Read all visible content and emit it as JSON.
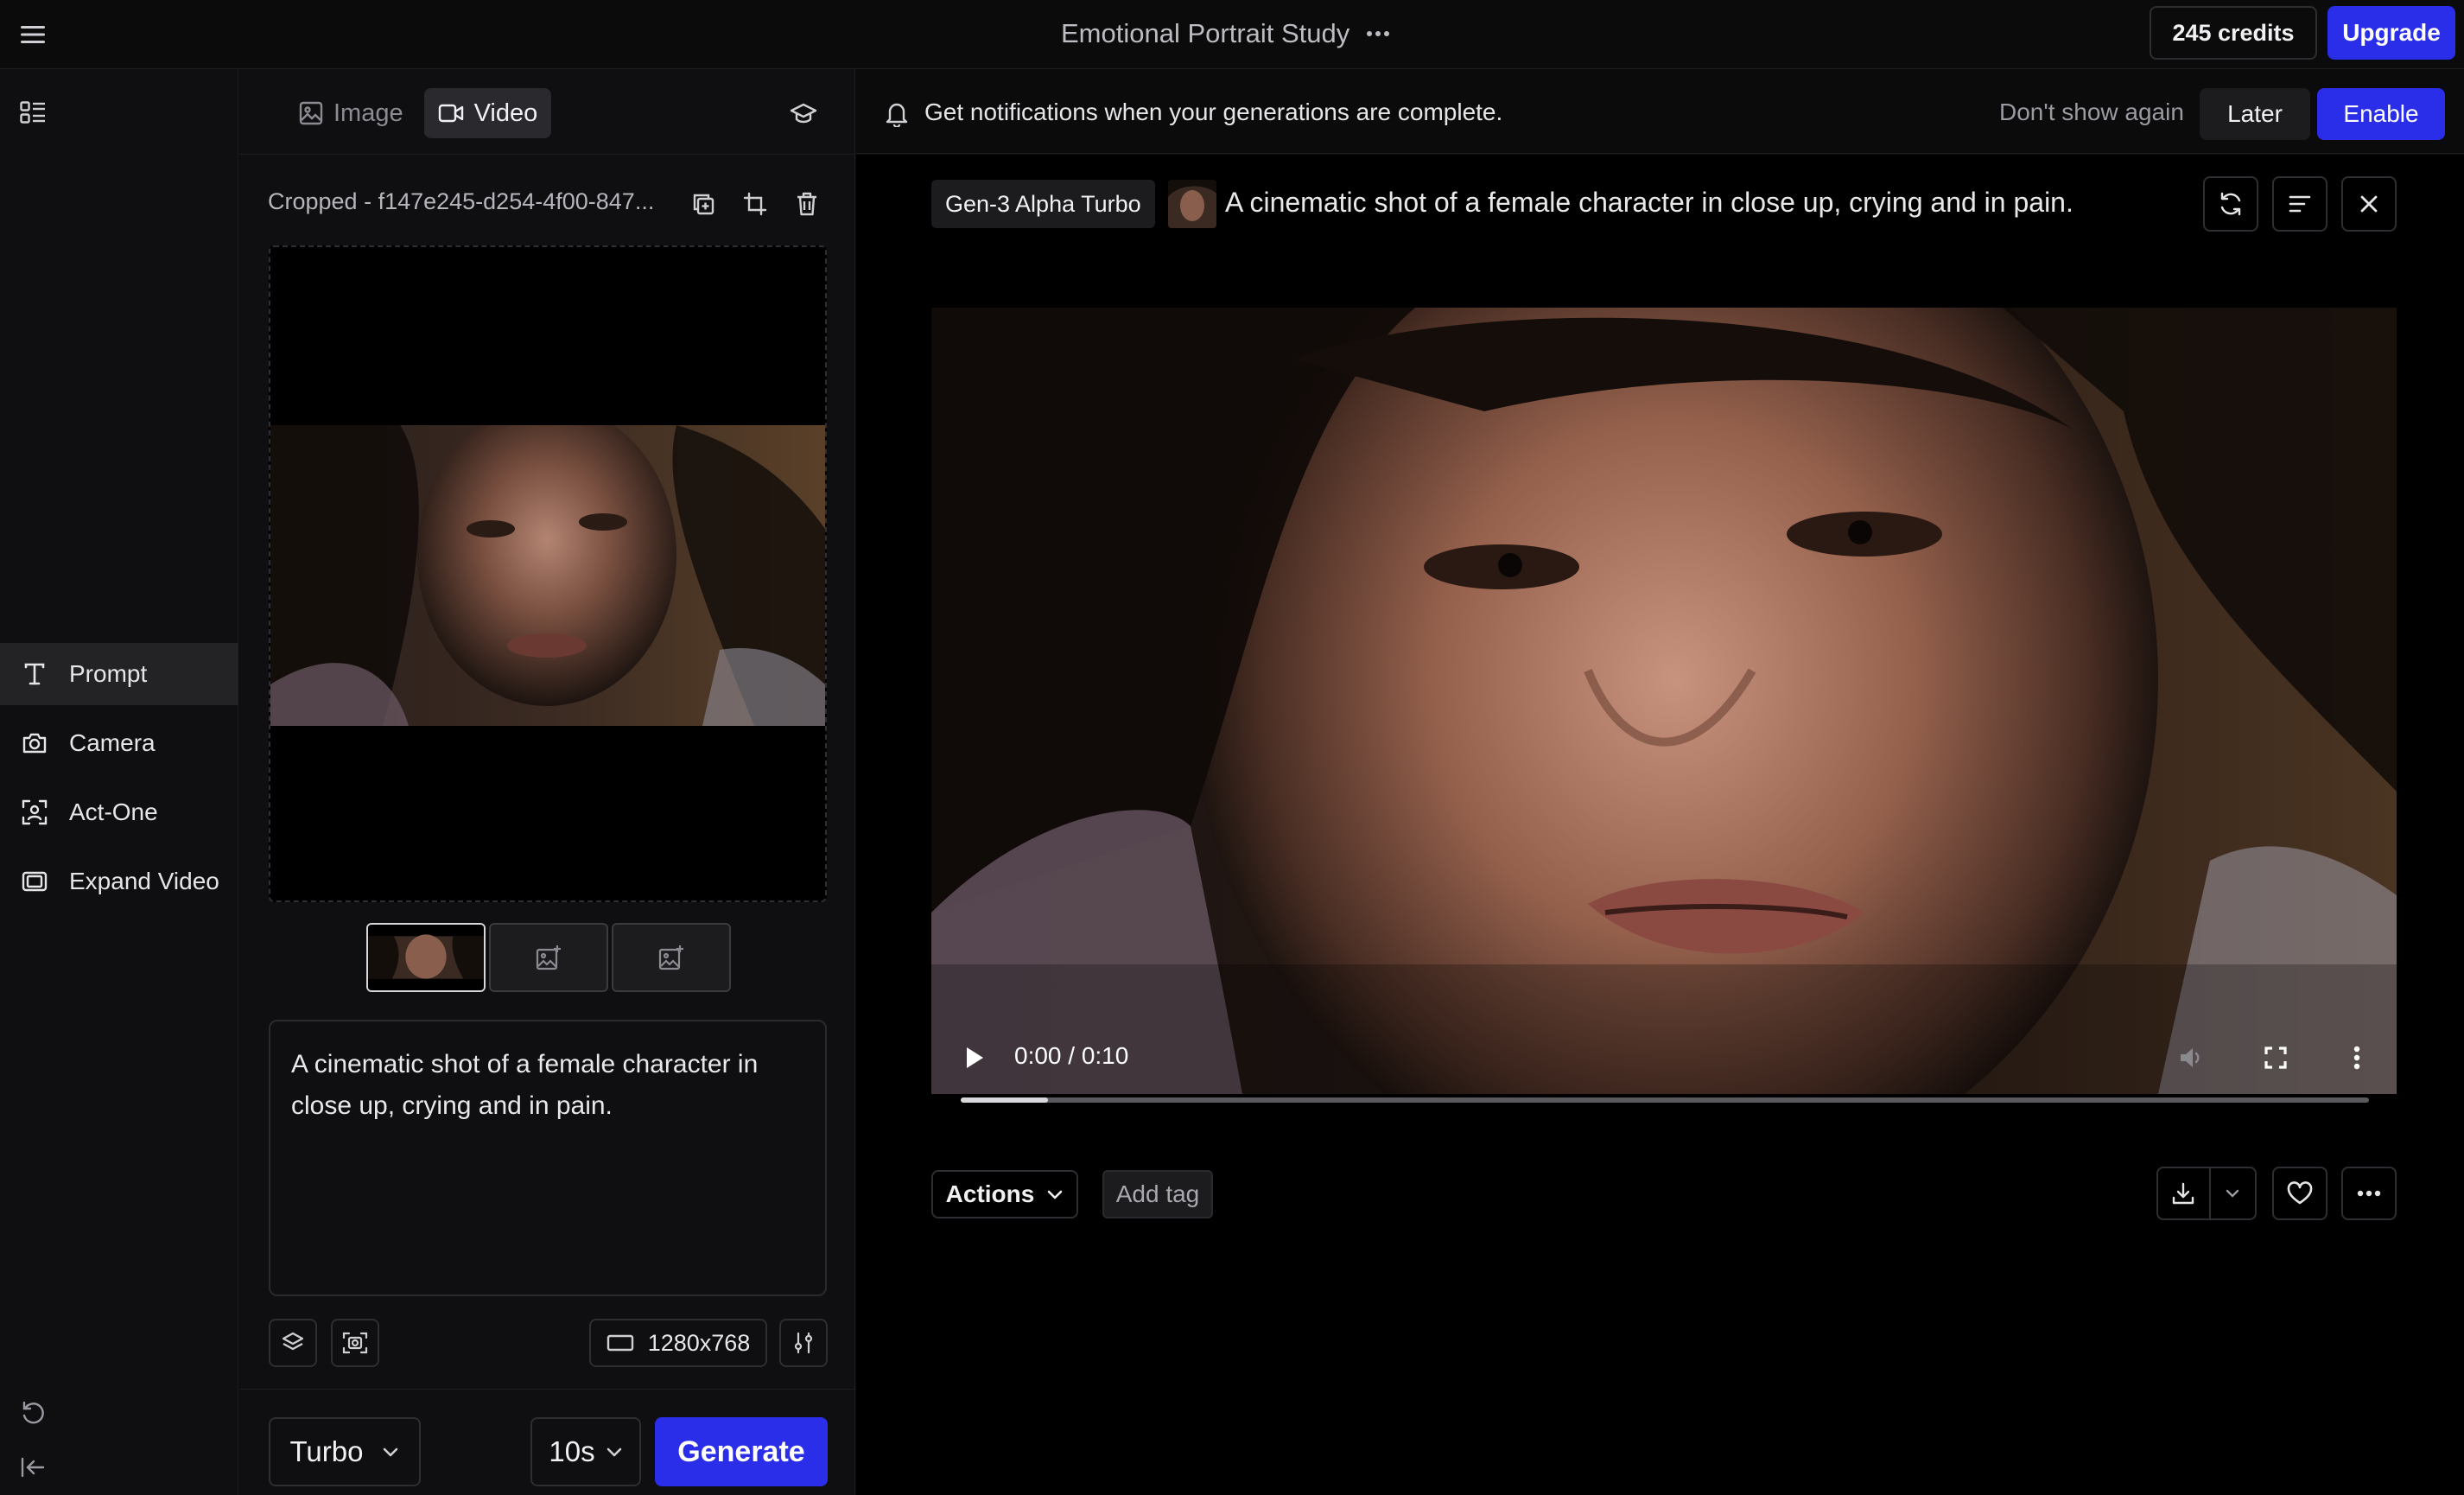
{
  "header": {
    "project_title": "Emotional Portrait Study",
    "credits_label": "245 credits",
    "upgrade_label": "Upgrade"
  },
  "mode_tabs": [
    {
      "label": "Image",
      "icon": "image-icon",
      "active": false
    },
    {
      "label": "Video",
      "icon": "video-icon",
      "active": true
    }
  ],
  "rail": {
    "items": [
      {
        "label": "Prompt",
        "icon": "text-icon",
        "active": true
      },
      {
        "label": "Camera",
        "icon": "camera-icon",
        "active": false
      },
      {
        "label": "Act-One",
        "icon": "face-scan-icon",
        "active": false
      },
      {
        "label": "Expand Video",
        "icon": "expand-icon",
        "active": false
      }
    ]
  },
  "panel": {
    "file_name": "Cropped - f147e245-d254-4f00-847...",
    "prompt_text": "A cinematic shot of a female character in close up, crying and in pain.",
    "resolution": "1280x768",
    "model": "Turbo",
    "duration": "10s",
    "generate_label": "Generate"
  },
  "notification": {
    "message": "Get notifications when your generations are complete.",
    "dont_show_label": "Don't show again",
    "later_label": "Later",
    "enable_label": "Enable"
  },
  "generation": {
    "model_badge": "Gen-3 Alpha Turbo",
    "prompt": "A cinematic shot of a female character in close up, crying and in pain.",
    "time_display": "0:00 / 0:10",
    "progress_fraction": 0.062,
    "actions_label": "Actions",
    "add_tag_label": "Add tag"
  },
  "colors": {
    "accent": "#2a2ee8",
    "background": "#0b0b0c",
    "panel": "#0f0f11"
  }
}
